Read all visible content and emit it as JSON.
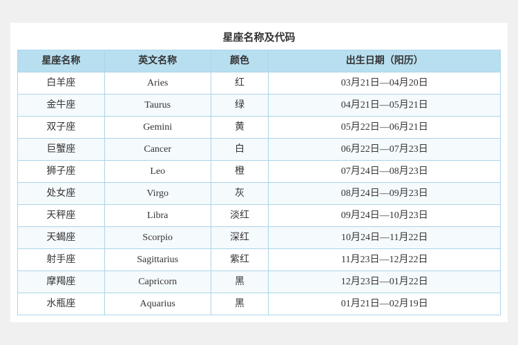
{
  "title": "星座名称及代码",
  "headers": {
    "zh_name": "星座名称",
    "en_name": "英文名称",
    "color": "颜色",
    "birth_date": "出生日期（阳历）"
  },
  "rows": [
    {
      "zh": "白羊座",
      "en": "Aries",
      "color": "红",
      "date": "03月21日—04月20日"
    },
    {
      "zh": "金牛座",
      "en": "Taurus",
      "color": "绿",
      "date": "04月21日—05月21日"
    },
    {
      "zh": "双子座",
      "en": "Gemini",
      "color": "黄",
      "date": "05月22日—06月21日"
    },
    {
      "zh": "巨蟹座",
      "en": "Cancer",
      "color": "白",
      "date": "06月22日—07月23日"
    },
    {
      "zh": "狮子座",
      "en": "Leo",
      "color": "橙",
      "date": "07月24日—08月23日"
    },
    {
      "zh": "处女座",
      "en": "Virgo",
      "color": "灰",
      "date": "08月24日—09月23日"
    },
    {
      "zh": "天秤座",
      "en": "Libra",
      "color": "淡红",
      "date": "09月24日—10月23日"
    },
    {
      "zh": "天蝎座",
      "en": "Scorpio",
      "color": "深红",
      "date": "10月24日—11月22日"
    },
    {
      "zh": "射手座",
      "en": "Sagittarius",
      "color": "紫红",
      "date": "11月23日—12月22日"
    },
    {
      "zh": "摩羯座",
      "en": "Capricorn",
      "color": "黑",
      "date": "12月23日—01月22日"
    },
    {
      "zh": "水瓶座",
      "en": "Aquarius",
      "color": "黑",
      "date": "01月21日—02月19日"
    }
  ]
}
